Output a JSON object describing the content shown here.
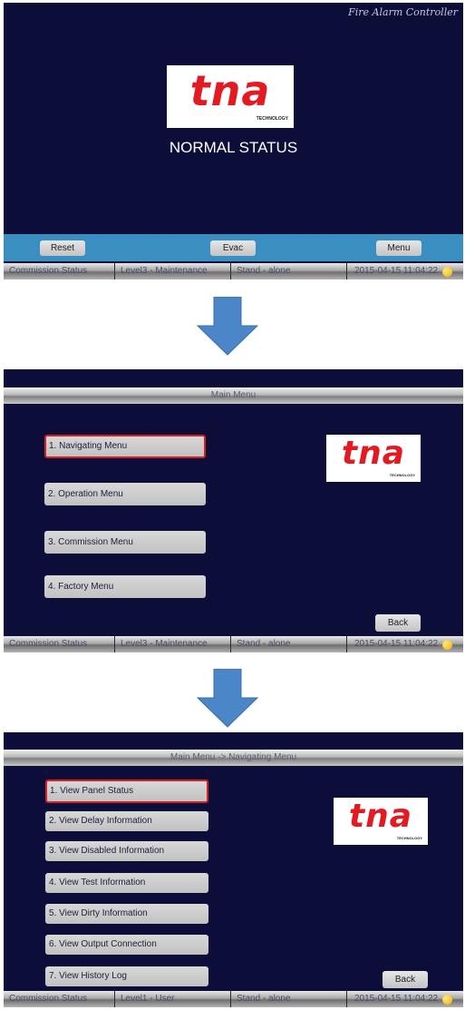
{
  "screen1": {
    "header_brand": "Fire Alarm Controller",
    "logo": {
      "word": "tna",
      "tech": "TECHNOLOGY"
    },
    "status_message": "NORMAL STATUS",
    "buttons": {
      "reset": "Reset",
      "evac": "Evac",
      "menu": "Menu"
    },
    "status": [
      "Commission Status",
      "Level3 - Maintenance",
      "Stand - alone",
      "2015-04-15 11:04:22"
    ]
  },
  "screen2": {
    "title": "Main Menu",
    "logo": {
      "word": "tna",
      "tech": "TECHNOLOGY"
    },
    "items": [
      "1. Navigating Menu",
      "2. Operation Menu",
      "3. Commission Menu",
      "4. Factory Menu"
    ],
    "back": "Back",
    "status": [
      "Commission Status",
      "Level3 - Maintenance",
      "Stand - alone",
      "2015-04-15 11:04:22"
    ]
  },
  "screen3": {
    "title": "Main Menu -> Navigating Menu",
    "logo": {
      "word": "tna",
      "tech": "TECHNOLOGY"
    },
    "items": [
      "1. View Panel Status",
      "2. View Delay Information",
      "3. View Disabled Information",
      "4. View Test Information",
      "5. View Dirty Information",
      "6. View Output Connection",
      "7. View History Log"
    ],
    "back": "Back",
    "status": [
      "Commission Status",
      "Level1 - User",
      "Stand - alone",
      "2015-04-15 11:04:22"
    ]
  },
  "colors": {
    "screen_bg": "#0d0d3a",
    "button_bar": "#3a8fc0",
    "logo_red": "#e21b23",
    "arrow": "#4a86c8",
    "selected_border": "#d82020"
  },
  "icons": [
    "arrow-down-icon",
    "status-indicator-icon"
  ]
}
